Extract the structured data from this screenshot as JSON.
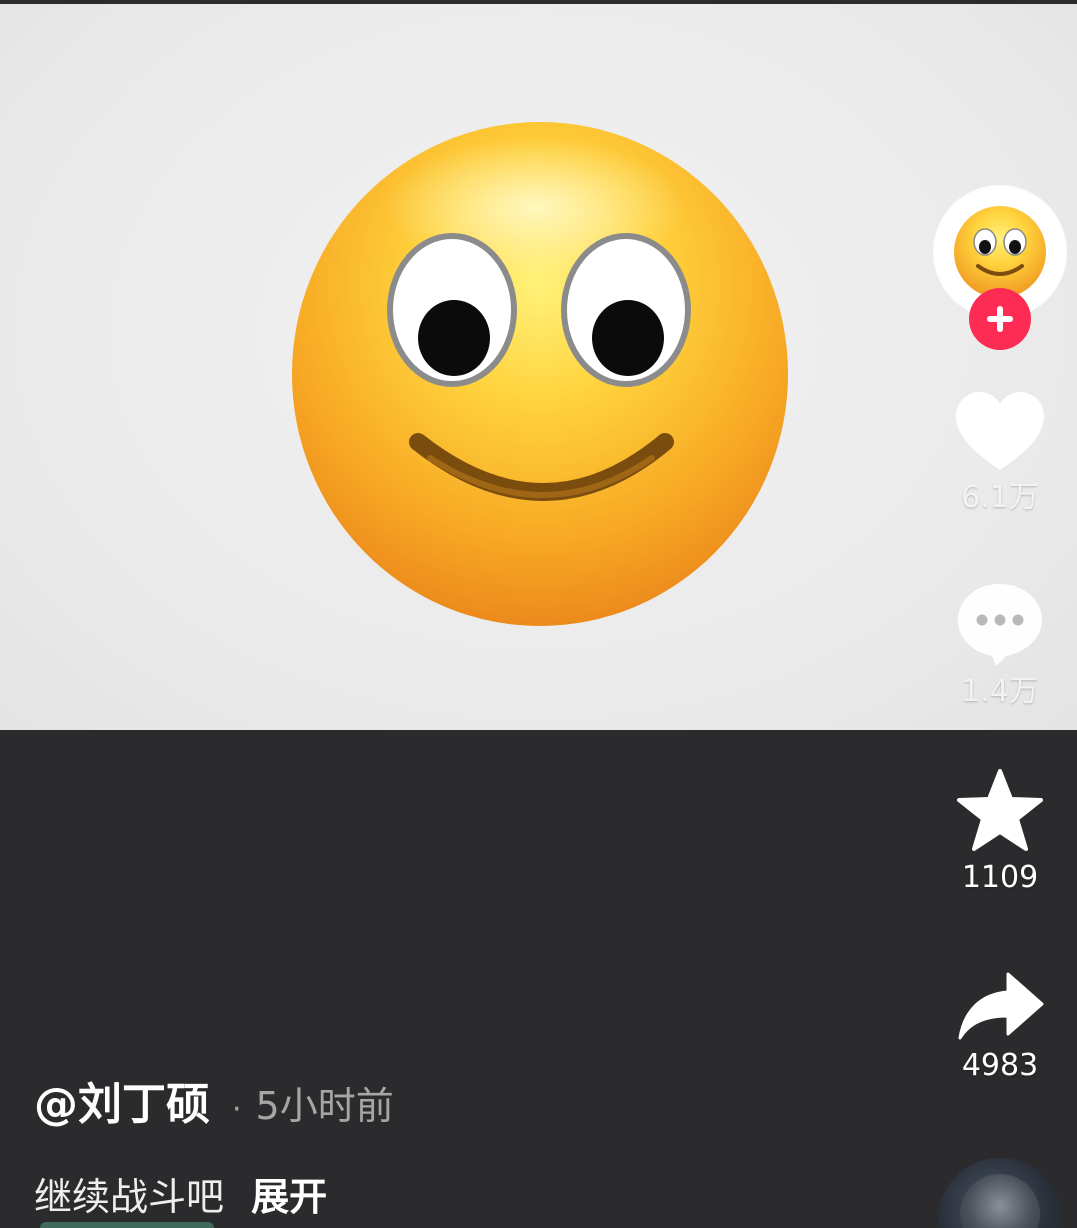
{
  "video": {
    "content_icon": "smiling-face-emoji"
  },
  "sidebar": {
    "avatar_icon": "smiling-face-emoji",
    "follow_icon": "plus-icon",
    "follow_color": "#fe2c55",
    "like": {
      "icon": "heart-icon",
      "count": "6.1万"
    },
    "comment": {
      "icon": "comment-bubble-icon",
      "count": "1.4万"
    },
    "favorite": {
      "icon": "star-icon",
      "count": "1109"
    },
    "share": {
      "icon": "share-arrow-icon",
      "count": "4983"
    },
    "music_disc_icon": "music-disc-icon"
  },
  "caption": {
    "author": "@刘丁硕",
    "separator": "·",
    "time_ago": "5小时前",
    "description": "继续战斗吧",
    "expand_label": "展开"
  },
  "colors": {
    "background": "#2b2b2d",
    "video_bg": "#ececec",
    "accent": "#fe2c55",
    "secondary_text": "#a6a6a6"
  }
}
